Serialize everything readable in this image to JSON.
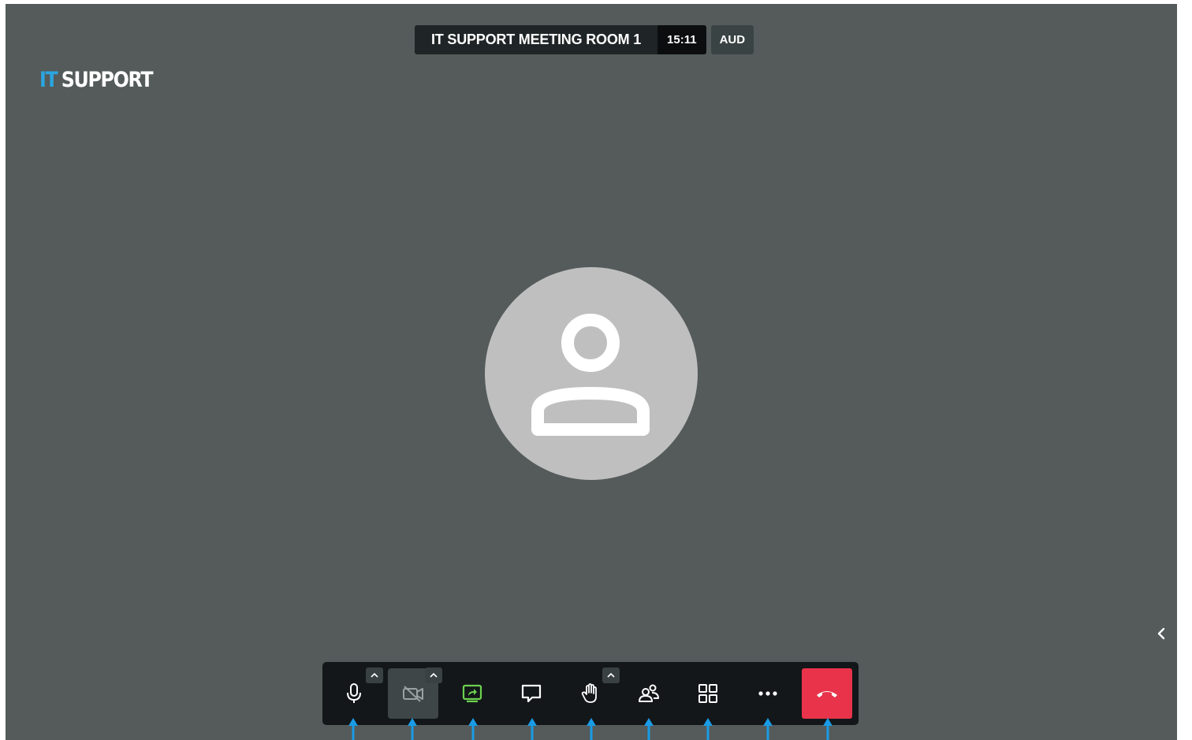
{
  "header": {
    "meeting_title": "IT SUPPORT MEETING ROOM 1",
    "timer": "15:11",
    "badge": "AUD"
  },
  "logo": {
    "part1": "IT",
    "part2": "SUPPORT"
  },
  "colors": {
    "stage_background": "#545b5a",
    "toolbar_background": "#131719",
    "logo_accent": "#2aa5e0",
    "screenshare_active": "#6bd14e",
    "hangup": "#e8334a",
    "pointer_arrow": "#1a9be6"
  },
  "participant": {
    "avatar_icon": "user-placeholder-icon"
  },
  "toolbar": {
    "buttons": [
      {
        "name": "microphone",
        "icon": "microphone-icon",
        "has_options": true
      },
      {
        "name": "camera",
        "icon": "camera-off-icon",
        "has_options": true,
        "state": "off"
      },
      {
        "name": "screen-share",
        "icon": "screen-share-icon",
        "state": "active"
      },
      {
        "name": "chat",
        "icon": "chat-icon"
      },
      {
        "name": "raise-hand",
        "icon": "hand-icon",
        "has_options": true
      },
      {
        "name": "participants",
        "icon": "participants-icon"
      },
      {
        "name": "tile-view",
        "icon": "grid-icon"
      },
      {
        "name": "more",
        "icon": "more-dots-icon"
      },
      {
        "name": "hangup",
        "icon": "phone-hangup-icon"
      }
    ]
  },
  "side_panel_toggle": {
    "icon": "chevron-left-icon"
  }
}
